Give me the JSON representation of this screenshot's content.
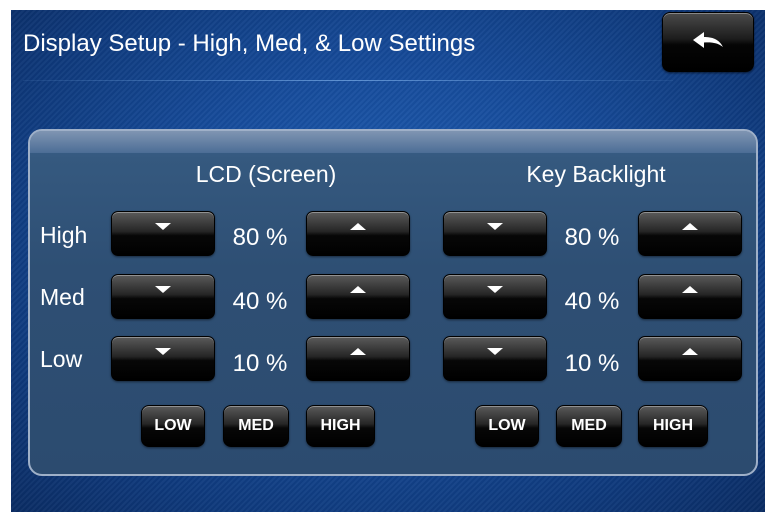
{
  "header": {
    "title": "Display Setup - High, Med, & Low Settings",
    "back_icon": "back-arrow-icon"
  },
  "lcd": {
    "title": "LCD (Screen)",
    "levels": [
      {
        "label": "High",
        "percent": 80
      },
      {
        "label": "Med",
        "percent": 40
      },
      {
        "label": "Low",
        "percent": 10
      }
    ],
    "presets": [
      "LOW",
      "MED",
      "HIGH"
    ]
  },
  "backlight": {
    "title": "Key Backlight",
    "levels": [
      {
        "label": "High",
        "percent": 80
      },
      {
        "label": "Med",
        "percent": 40
      },
      {
        "label": "Low",
        "percent": 10
      }
    ],
    "presets": [
      "LOW",
      "MED",
      "HIGH"
    ]
  },
  "colors": {
    "background": "#174d9d",
    "panel": "#2e4f74",
    "button": "#000000",
    "text": "#ffffff"
  }
}
